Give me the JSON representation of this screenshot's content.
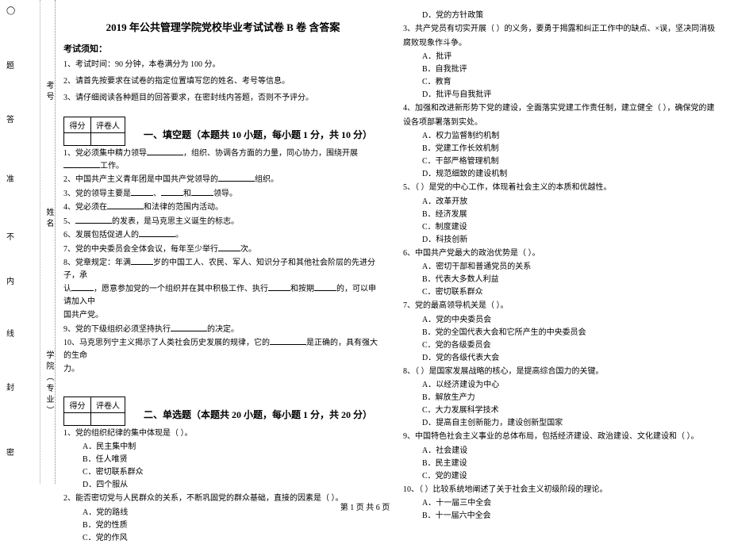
{
  "binding": {
    "circle_top": "◯",
    "circle_mid": "◯",
    "marks": [
      "密",
      "封",
      "线",
      "内",
      "不",
      "准",
      "答",
      "题"
    ],
    "fields": {
      "school": "学院（专业）",
      "name": "姓名",
      "id": "考号"
    }
  },
  "title": "2019 年公共管理学院党校毕业考试试卷 B 卷  含答案",
  "notice": {
    "heading": "考试须知：",
    "items": [
      "1、考试时间：90 分钟，本卷满分为 100 分。",
      "2、请首先按要求在试卷的指定位置填写您的姓名、考号等信息。",
      "3、请仔细阅读各种题目的回答要求，在密封线内答题，否则不予评分。"
    ]
  },
  "score_labels": {
    "score": "得分",
    "marker": "评卷人"
  },
  "section1": {
    "title": "一、填空题（本题共 10 小题，每小题 1 分，共 10 分）",
    "q1_a": "1、党必须集中精力领导",
    "q1_b": "，组织、协调各方面的力量，同心协力，围绕开展",
    "q1_c": "工作。",
    "q2": "2、中国共产主义青年团是中国共产党领导的",
    "q2_b": "组织。",
    "q3_a": "3、党的领导主要是",
    "q3_b": "、",
    "q3_c": "和",
    "q3_d": "领导。",
    "q4_a": "4、党必须在",
    "q4_b": "和法律的范围内活动。",
    "q5_a": "5、",
    "q5_b": "的发表，是马克思主义诞生的标志。",
    "q6": "6、发展包括促进人的",
    "q6_b": "。",
    "q7_a": "7、党的中央委员会全体会议，每年至少举行",
    "q7_b": "次。",
    "q8_a": "8、党章规定：年满",
    "q8_b": "岁的中国工人、农民、军人、知识分子和其他社会阶层的先进分子，承",
    "q8_c": "认",
    "q8_d": "，愿意参加党的一个组织并在其中积极工作、执行",
    "q8_e": "和按期",
    "q8_f": "的，可以申请加入中",
    "q8_g": "国共产党。",
    "q9_a": "9、党的下级组织必须坚持执行",
    "q9_b": "的决定。",
    "q10_a": "10、马克思列宁主义揭示了人类社会历史发展的规律，它的",
    "q10_b": "是正确的，具有强大的生命",
    "q10_c": "力。"
  },
  "section2": {
    "title": "二、单选题（本题共 20 小题，每小题 1 分，共 20 分）",
    "q1": "1、党的组织纪律的集中体现是（     ）。",
    "q1o": [
      "A．民主集中制",
      "B．任人唯贤",
      "C．密切联系群众",
      "D．四个服从"
    ],
    "q2": "2、能否密切党与人民群众的关系，不断巩固党的群众基础，直接的因素是（     ）。",
    "q2o": [
      "A．党的路线",
      "B．党的性质",
      "C．党的作风",
      "D．党的方针政策"
    ],
    "q3": "3、共产党员有切实开展（     ）的义务，要勇于揭露和纠正工作中的缺点、×误，坚决同消极",
    "q3b": "腐败现象作斗争。",
    "q3o": [
      "A．批评",
      "B．自我批评",
      "C．教育",
      "D．批评与自我批评"
    ],
    "q4": "4、加强和改进新形势下党的建设，全面落实党建工作责任制，建立健全（     ），确保党的建",
    "q4b": "设各项部署落到实处。",
    "q4o": [
      "A．权力监督制约机制",
      "B．党建工作长效机制",
      "C．干部严格管理机制",
      "D．规范细致的建设机制"
    ],
    "q5": "5、（     ）是党的中心工作，体现着社会主义的本质和优越性。",
    "q5o": [
      "A．改革开放",
      "B．经济发展",
      "C．制度建设",
      "D．科技创新"
    ],
    "q6": "6、中国共产党最大的政治优势是（     ）。",
    "q6o": [
      "A．密切干部和普通党员的关系",
      "B．代表大多数人利益",
      "C．密切联系群众"
    ],
    "q7": "7、党的最高领导机关是（     ）。",
    "q7o": [
      "A．党的中央委员会",
      "B．党的全国代表大会和它所产生的中央委员会",
      "C．党的各级委员会",
      "D．党的各级代表大会"
    ],
    "q8": "8、（     ）是国家发展战略的核心，是提高综合国力的关键。",
    "q8o": [
      "A．以经济建设为中心",
      "B．解放生产力",
      "C．大力发展科学技术",
      "D．提高自主创新能力，建设创新型国家"
    ],
    "q9": "9、中国特色社会主义事业的总体布局，包括经济建设、政治建设、文化建设和（     ）。",
    "q9o": [
      "A．社会建设",
      "B．民主建设",
      "C．党的建设"
    ],
    "q10": "10、（     ）比较系统地阐述了关于社会主义初级阶段的理论。",
    "q10o": [
      "A．十一届三中全会",
      "B．十一届六中全会"
    ]
  },
  "footer": "第 1 页 共 6 页"
}
